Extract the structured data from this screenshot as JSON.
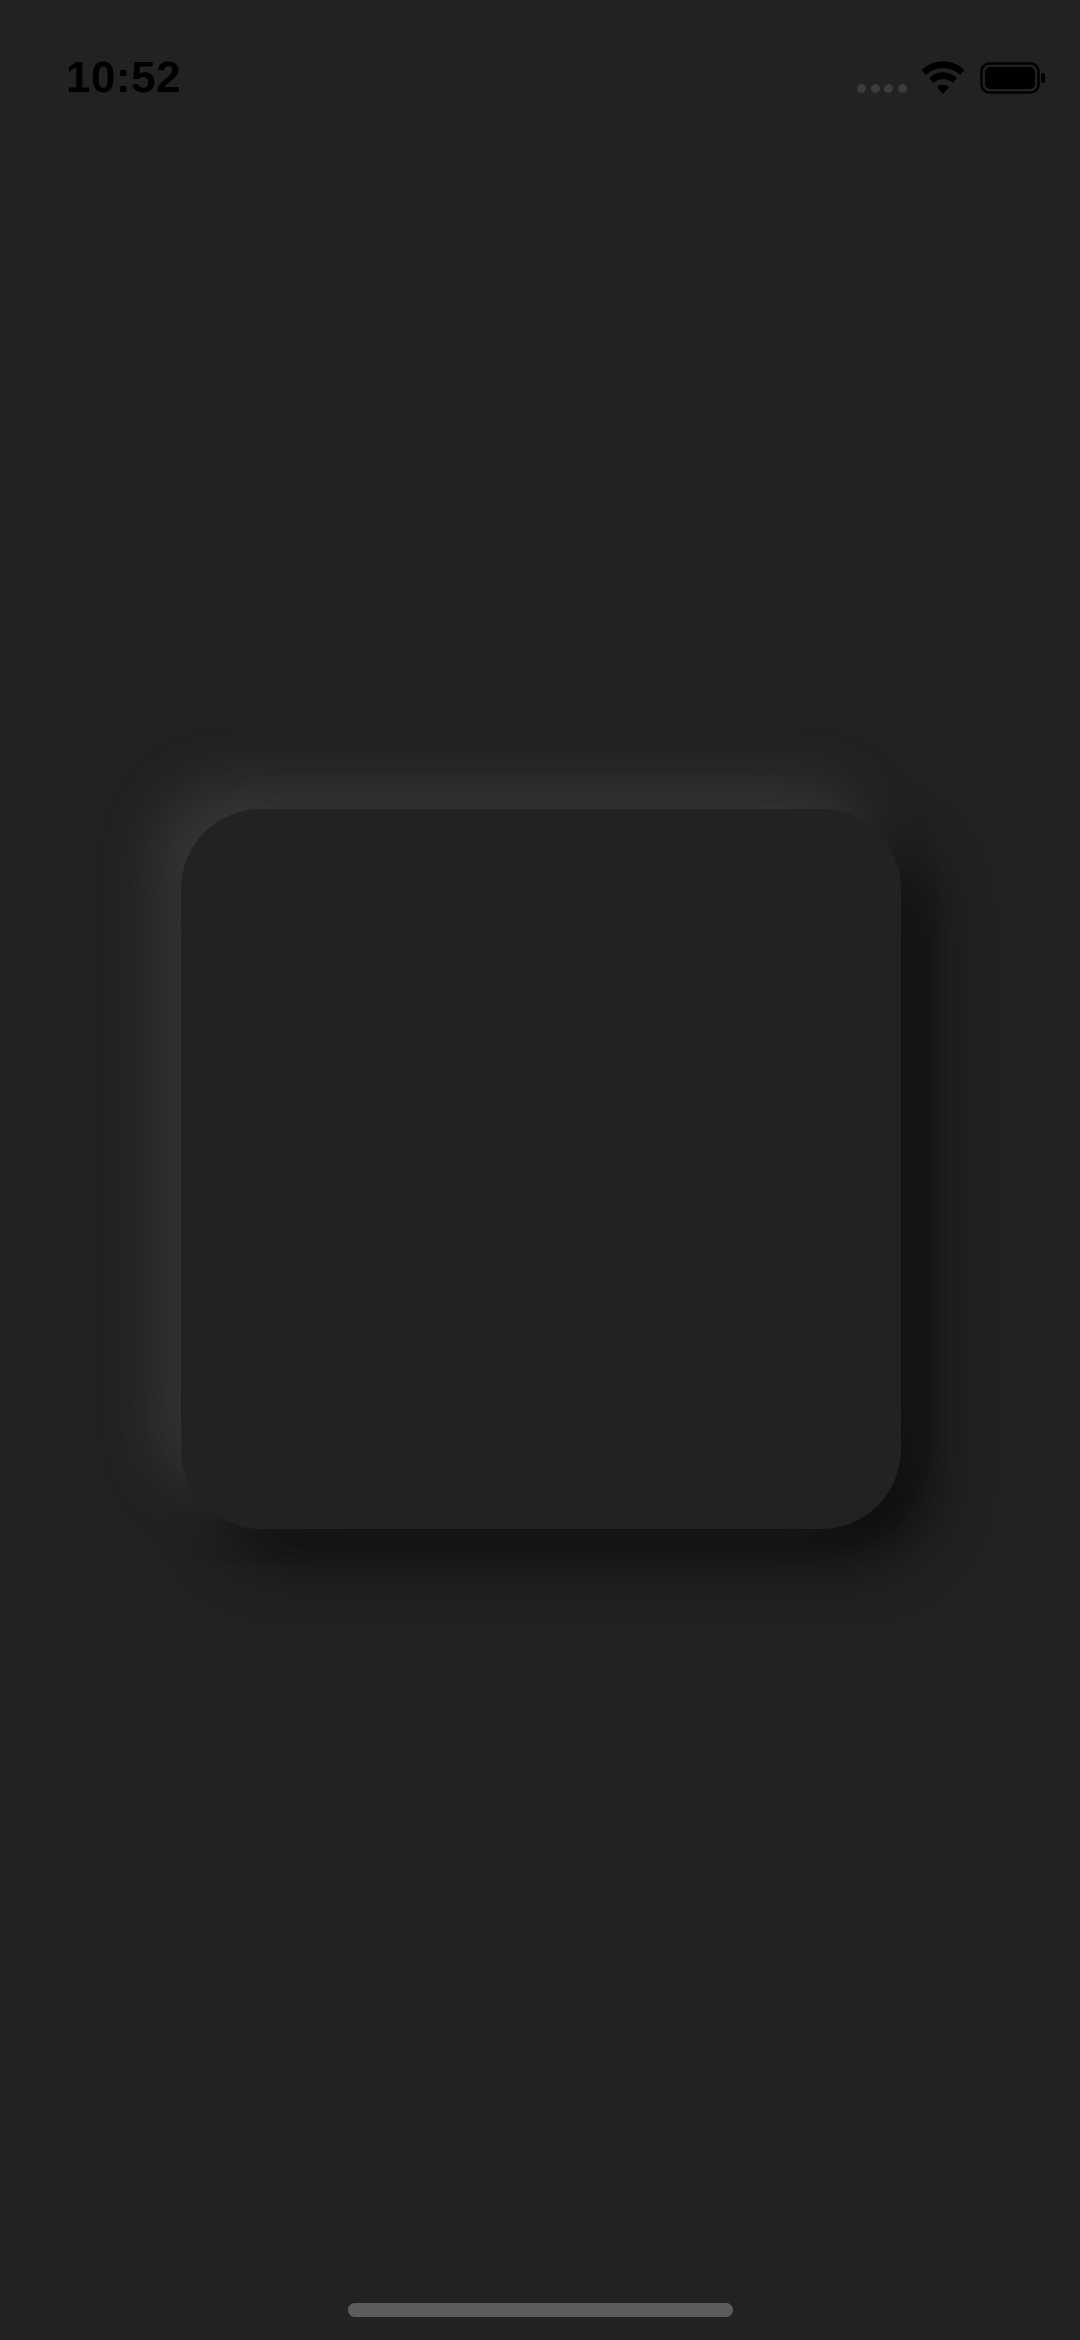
{
  "status_bar": {
    "time": "10:52",
    "icons": [
      "cellular-signal-icon",
      "wifi-icon",
      "battery-icon"
    ]
  },
  "colors": {
    "background": "#222222",
    "card": "#222222",
    "status_text": "#000000",
    "home_indicator": "#5c5c5c"
  }
}
